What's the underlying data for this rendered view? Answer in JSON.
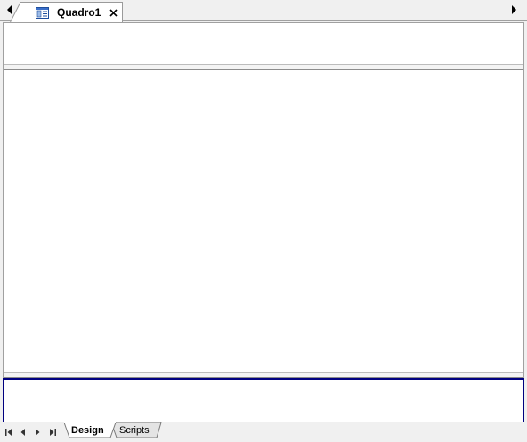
{
  "tabstrip": {
    "scroll_left_icon": "triangle-left-icon",
    "scroll_right_icon": "triangle-right-icon",
    "tabs": [
      {
        "label": "Quadro1",
        "icon": "form-layout-icon",
        "close_icon": "close-icon",
        "active": true
      }
    ]
  },
  "editor": {
    "bands": [
      "header",
      "body",
      "footer"
    ],
    "footer_border_color": "#000080"
  },
  "bottom_tabs": {
    "nav_icons": [
      "first-icon",
      "previous-icon",
      "next-icon",
      "last-icon"
    ],
    "tabs": [
      {
        "label": "Design",
        "active": true
      },
      {
        "label": "Scripts",
        "active": false
      }
    ]
  }
}
